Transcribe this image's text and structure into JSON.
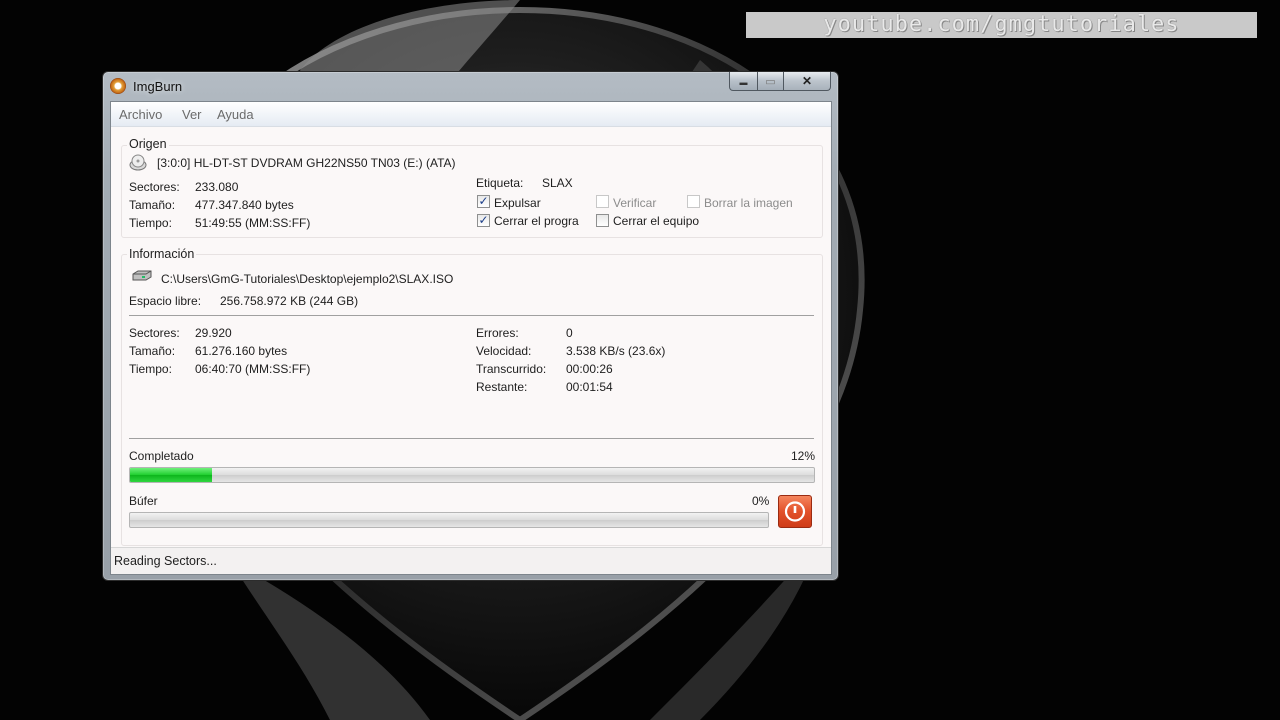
{
  "desktop": {
    "watermark": "youtube.com/gmgtutoriales"
  },
  "window": {
    "title": "ImgBurn",
    "close_glyph": "✕",
    "min_glyph": "▬",
    "max_glyph": "▭"
  },
  "menu": {
    "items": [
      "Archivo",
      "Ver",
      "Ayuda"
    ]
  },
  "source": {
    "title": "Origen",
    "drive": "[3:0:0] HL-DT-ST DVDRAM GH22NS50 TN03 (E:) (ATA)",
    "sectors_label": "Sectores:",
    "sectors_value": "233.080",
    "size_label": "Tamaño:",
    "size_value": "477.347.840 bytes",
    "time_label": "Tiempo:",
    "time_value": "51:49:55 (MM:SS:FF)",
    "label_label": "Etiqueta:",
    "label_value": "SLAX",
    "options": {
      "eject": {
        "label": "Expulsar",
        "checked": true,
        "enabled": true
      },
      "verify": {
        "label": "Verificar",
        "checked": false,
        "enabled": false
      },
      "delete_image": {
        "label": "Borrar la imagen",
        "checked": false,
        "enabled": false
      },
      "close_program": {
        "label": "Cerrar el progra",
        "checked": true,
        "enabled": true
      },
      "shutdown": {
        "label": "Cerrar el equipo",
        "checked": false,
        "enabled": true
      }
    }
  },
  "info": {
    "title": "Información",
    "dest_path": "C:\\Users\\GmG-Tutoriales\\Desktop\\ejemplo2\\SLAX.ISO",
    "free_label": "Espacio libre:",
    "free_value": "256.758.972 KB  (244 GB)",
    "sectors_label": "Sectores:",
    "sectors_value": "29.920",
    "size_label": "Tamaño:",
    "size_value": "61.276.160 bytes",
    "time_label": "Tiempo:",
    "time_value": "06:40:70 (MM:SS:FF)",
    "errors_label": "Errores:",
    "errors_value": "0",
    "speed_label": "Velocidad:",
    "speed_value": "3.538 KB/s (23.6x)",
    "elapsed_label": "Transcurrido:",
    "elapsed_value": "00:00:26",
    "remaining_label": "Restante:",
    "remaining_value": "00:01:54",
    "completed_label": "Completado",
    "completed_percent": "12%",
    "completed_fraction": 0.12,
    "buffer_label": "Búfer",
    "buffer_percent": "0%",
    "buffer_fraction": 0.0
  },
  "status": {
    "text": "Reading Sectors..."
  },
  "colors": {
    "progress_green": "#1fcf2f",
    "stop_button": "#e2512a",
    "window_frame": "#a3acb4"
  },
  "icons": {
    "app": "imgburn-disc-icon",
    "drive": "optical-drive-icon",
    "file": "hard-disk-icon",
    "stop": "power-icon"
  }
}
